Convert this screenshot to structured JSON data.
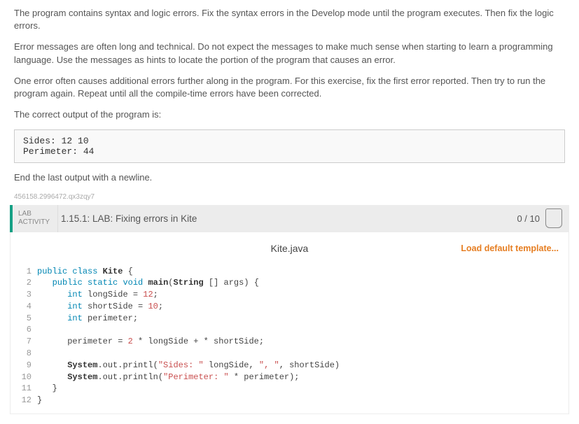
{
  "intro": {
    "p1": "The program contains syntax and logic errors. Fix the syntax errors in the Develop mode until the program executes. Then fix the logic errors.",
    "p2": "Error messages are often long and technical. Do not expect the messages to make much sense when starting to learn a programming language. Use the messages as hints to locate the portion of the program that causes an error.",
    "p3": "One error often causes additional errors further along in the program. For this exercise, fix the first error reported. Then try to run the program again. Repeat until all the compile-time errors have been corrected.",
    "p4": "The correct output of the program is:",
    "sample_output": "Sides: 12 10\nPerimeter: 44",
    "p5": "End the last output with a newline.",
    "meta_id": "456158.2996472.qx3zqy7"
  },
  "lab": {
    "tag_line1": "LAB",
    "tag_line2": "ACTIVITY",
    "title": "1.15.1: LAB: Fixing errors in Kite",
    "score": "0 / 10"
  },
  "editor": {
    "filename": "Kite.java",
    "load_template": "Load default template...",
    "line_numbers": "1\n2\n3\n4\n5\n6\n7\n8\n9\n10\n11\n12",
    "code_lines": [
      {
        "indent": "",
        "tokens": [
          [
            "kw",
            "public"
          ],
          [
            "",
            " "
          ],
          [
            "kw",
            "class"
          ],
          [
            "",
            " "
          ],
          [
            "cl",
            "Kite"
          ],
          [
            "",
            " {"
          ]
        ]
      },
      {
        "indent": "   ",
        "tokens": [
          [
            "kw",
            "public"
          ],
          [
            "",
            " "
          ],
          [
            "kw",
            "static"
          ],
          [
            "",
            " "
          ],
          [
            "kw",
            "void"
          ],
          [
            "",
            " "
          ],
          [
            "cl",
            "main"
          ],
          [
            "",
            "("
          ],
          [
            "cl",
            "String"
          ],
          [
            "",
            " [] args) {"
          ]
        ]
      },
      {
        "indent": "      ",
        "tokens": [
          [
            "kw",
            "int"
          ],
          [
            "",
            " longSide = "
          ],
          [
            "num",
            "12"
          ],
          [
            "",
            ";"
          ]
        ]
      },
      {
        "indent": "      ",
        "tokens": [
          [
            "kw",
            "int"
          ],
          [
            "",
            " shortSide = "
          ],
          [
            "num",
            "10"
          ],
          [
            "",
            ";"
          ]
        ]
      },
      {
        "indent": "      ",
        "tokens": [
          [
            "kw",
            "int"
          ],
          [
            "",
            " perimeter;"
          ]
        ]
      },
      {
        "indent": "",
        "tokens": []
      },
      {
        "indent": "      ",
        "tokens": [
          [
            "",
            "perimeter = "
          ],
          [
            "num",
            "2"
          ],
          [
            "",
            " * longSide + * shortSide;"
          ]
        ]
      },
      {
        "indent": "",
        "tokens": []
      },
      {
        "indent": "      ",
        "tokens": [
          [
            "cl",
            "System"
          ],
          [
            "",
            ".out.printl("
          ],
          [
            "str",
            "\"Sides: \""
          ],
          [
            "",
            " longSide, "
          ],
          [
            "str",
            "\", \""
          ],
          [
            "",
            ", shortSide)"
          ]
        ]
      },
      {
        "indent": "      ",
        "tokens": [
          [
            "cl",
            "System"
          ],
          [
            "",
            ".out.println("
          ],
          [
            "str",
            "\"Perimeter: \""
          ],
          [
            "",
            " * perimeter);"
          ]
        ]
      },
      {
        "indent": "   ",
        "tokens": [
          [
            "",
            "}"
          ]
        ]
      },
      {
        "indent": "",
        "tokens": [
          [
            "",
            "}"
          ]
        ]
      }
    ]
  }
}
